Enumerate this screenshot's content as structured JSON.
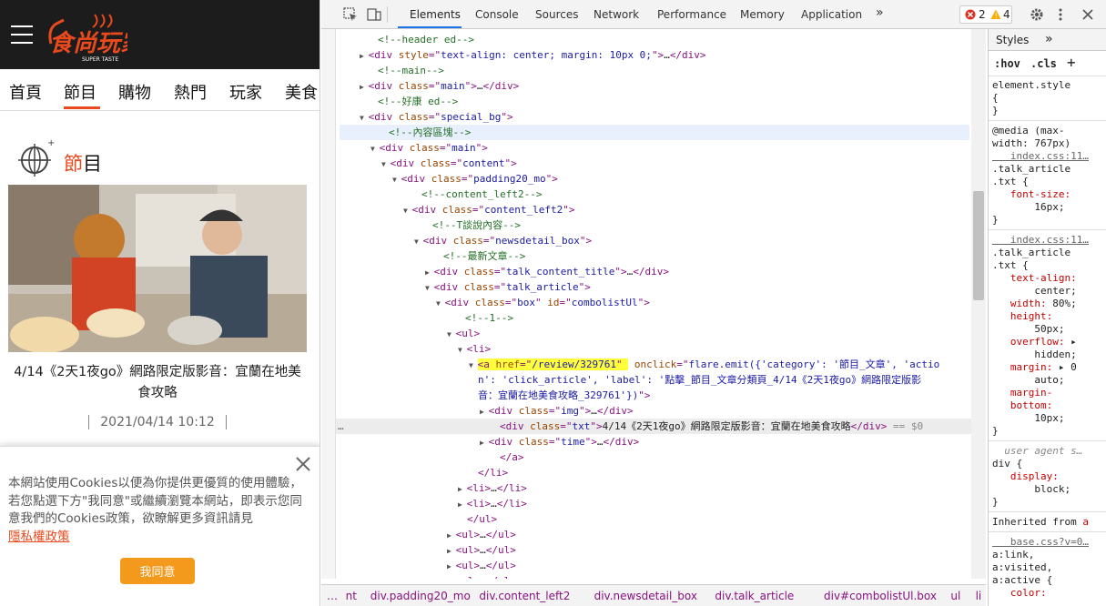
{
  "site": {
    "logo_text": "食尚玩家",
    "logo_sub": "SUPER TASTE",
    "nav": [
      "首頁",
      "節目",
      "購物",
      "熱門",
      "玩家",
      "美食"
    ],
    "section_title_hl": "節",
    "section_title_rest": "目",
    "article_title": "4/14《2天1夜go》網路限定版影音：宜蘭在地美食攻略",
    "article_time": "2021/04/14 10:12",
    "cookie_text": "本網站使用Cookies以便為你提供更優質的使用體驗，若您點選下方\"我同意\"或繼續瀏覽本網站，即表示您同意我們的Cookies政策，欲瞭解更多資訊請見",
    "cookie_link": "隱私權政策",
    "cookie_button": "我同意"
  },
  "devtools": {
    "tabs": [
      "Elements",
      "Console",
      "Sources",
      "Network",
      "Performance",
      "Memory",
      "Application"
    ],
    "more": "»",
    "errors": "2",
    "warnings": "4",
    "dom_lines": [
      {
        "indent": 62,
        "parts": [
          [
            "cmt",
            "<!--header ed-->"
          ]
        ]
      },
      {
        "indent": 52,
        "tri": "▶",
        "parts": [
          [
            "tag",
            "<div "
          ],
          [
            "attr",
            "style"
          ],
          [
            "tag",
            "=\""
          ],
          [
            "val",
            "text-align: center; margin: 10px 0;"
          ],
          [
            "tag",
            "\">"
          ],
          [
            "txt",
            "…"
          ],
          [
            "tag",
            "</div>"
          ]
        ]
      },
      {
        "indent": 62,
        "parts": [
          [
            "cmt",
            "<!--main-->"
          ]
        ]
      },
      {
        "indent": 52,
        "tri": "▶",
        "parts": [
          [
            "tag",
            "<div "
          ],
          [
            "attr",
            "class"
          ],
          [
            "tag",
            "=\""
          ],
          [
            "val",
            "main"
          ],
          [
            "tag",
            "\">"
          ],
          [
            "txt",
            "…"
          ],
          [
            "tag",
            "</div>"
          ]
        ]
      },
      {
        "indent": 62,
        "parts": [
          [
            "cmt",
            "<!--好康 ed-->"
          ]
        ]
      },
      {
        "indent": 52,
        "tri": "▼",
        "parts": [
          [
            "tag",
            "<div "
          ],
          [
            "attr",
            "class"
          ],
          [
            "tag",
            "=\""
          ],
          [
            "val",
            "special_bg"
          ],
          [
            "tag",
            "\">"
          ]
        ]
      },
      {
        "indent": 74,
        "sel": true,
        "parts": [
          [
            "cmt",
            "<!--內容區塊-->"
          ]
        ]
      },
      {
        "indent": 64,
        "tri": "▼",
        "parts": [
          [
            "tag",
            "<div "
          ],
          [
            "attr",
            "class"
          ],
          [
            "tag",
            "=\""
          ],
          [
            "val",
            "main"
          ],
          [
            "tag",
            "\">"
          ]
        ]
      },
      {
        "indent": 76,
        "tri": "▼",
        "parts": [
          [
            "tag",
            "<div "
          ],
          [
            "attr",
            "class"
          ],
          [
            "tag",
            "=\""
          ],
          [
            "val",
            "content"
          ],
          [
            "tag",
            "\">"
          ]
        ]
      },
      {
        "indent": 88,
        "tri": "▼",
        "parts": [
          [
            "tag",
            "<div "
          ],
          [
            "attr",
            "class"
          ],
          [
            "tag",
            "=\""
          ],
          [
            "val",
            "padding20_mo"
          ],
          [
            "tag",
            "\">"
          ]
        ]
      },
      {
        "indent": 110,
        "parts": [
          [
            "cmt",
            "<!--content_left2-->"
          ]
        ]
      },
      {
        "indent": 100,
        "tri": "▼",
        "parts": [
          [
            "tag",
            "<div "
          ],
          [
            "attr",
            "class"
          ],
          [
            "tag",
            "=\""
          ],
          [
            "val",
            "content_left2"
          ],
          [
            "tag",
            "\">"
          ]
        ]
      },
      {
        "indent": 122,
        "parts": [
          [
            "cmt",
            "<!--T談說內容-->"
          ]
        ]
      },
      {
        "indent": 112,
        "tri": "▼",
        "parts": [
          [
            "tag",
            "<div "
          ],
          [
            "attr",
            "class"
          ],
          [
            "tag",
            "=\""
          ],
          [
            "val",
            "newsdetail_box"
          ],
          [
            "tag",
            "\">"
          ]
        ]
      },
      {
        "indent": 134,
        "parts": [
          [
            "cmt",
            "<!--最新文章-->"
          ]
        ]
      },
      {
        "indent": 124,
        "tri": "▶",
        "parts": [
          [
            "tag",
            "<div "
          ],
          [
            "attr",
            "class"
          ],
          [
            "tag",
            "=\""
          ],
          [
            "val",
            "talk_content_title"
          ],
          [
            "tag",
            "\">"
          ],
          [
            "txt",
            "…"
          ],
          [
            "tag",
            "</div>"
          ]
        ]
      },
      {
        "indent": 124,
        "tri": "▼",
        "parts": [
          [
            "tag",
            "<div "
          ],
          [
            "attr",
            "class"
          ],
          [
            "tag",
            "=\""
          ],
          [
            "val",
            "talk_article"
          ],
          [
            "tag",
            "\">"
          ]
        ]
      },
      {
        "indent": 136,
        "tri": "▼",
        "parts": [
          [
            "tag",
            "<div "
          ],
          [
            "attr",
            "class"
          ],
          [
            "tag",
            "=\""
          ],
          [
            "val",
            "box"
          ],
          [
            "tag",
            "\" "
          ],
          [
            "attr",
            "id"
          ],
          [
            "tag",
            "=\""
          ],
          [
            "val",
            "combolistUl"
          ],
          [
            "tag",
            "\">"
          ]
        ]
      },
      {
        "indent": 158,
        "parts": [
          [
            "cmt",
            "<!--1-->"
          ]
        ]
      },
      {
        "indent": 148,
        "tri": "▼",
        "parts": [
          [
            "tag",
            "<ul>"
          ]
        ]
      },
      {
        "indent": 160,
        "tri": "▼",
        "parts": [
          [
            "tag",
            "<li>"
          ]
        ]
      },
      {
        "indent": 172,
        "tri": "▼",
        "yellow": true,
        "parts": [
          [
            "tag",
            "<a "
          ],
          [
            "attr",
            "href"
          ],
          [
            "tag",
            "=\""
          ],
          [
            "val",
            "/review/329761"
          ],
          [
            "tag",
            "\" "
          ],
          [
            "attr",
            " onclick"
          ],
          [
            "tag",
            "=\""
          ],
          [
            "val",
            "flare.emit({'category': '節目_文章', 'actio"
          ]
        ]
      },
      {
        "indent": 172,
        "parts": [
          [
            "val",
            "n': 'click_article', 'label': '點擊_節目_文章分類頁_4/14《2天1夜go》網路限定版影"
          ]
        ]
      },
      {
        "indent": 172,
        "parts": [
          [
            "val",
            "音：宜蘭在地美食攻略_329761'})"
          ],
          [
            "tag",
            "\">"
          ]
        ]
      },
      {
        "indent": 184,
        "tri": "▶",
        "parts": [
          [
            "tag",
            "<div "
          ],
          [
            "attr",
            "class"
          ],
          [
            "tag",
            "=\""
          ],
          [
            "val",
            "img"
          ],
          [
            "tag",
            "\">"
          ],
          [
            "txt",
            "…"
          ],
          [
            "tag",
            "</div>"
          ]
        ]
      },
      {
        "indent": 196,
        "sel2": true,
        "dots": "…",
        "parts": [
          [
            "tag",
            "<div "
          ],
          [
            "attr",
            "class"
          ],
          [
            "tag",
            "=\""
          ],
          [
            "val",
            "txt"
          ],
          [
            "tag",
            "\">"
          ],
          [
            "txt",
            "4/14《2天1夜go》網路限定版影音：宜蘭在地美食攻略"
          ],
          [
            "tag",
            "</div>"
          ],
          [
            "eq",
            " == $0"
          ]
        ]
      },
      {
        "indent": 184,
        "tri": "▶",
        "parts": [
          [
            "tag",
            "<div "
          ],
          [
            "attr",
            "class"
          ],
          [
            "tag",
            "=\""
          ],
          [
            "val",
            "time"
          ],
          [
            "tag",
            "\">"
          ],
          [
            "txt",
            "…"
          ],
          [
            "tag",
            "</div>"
          ]
        ]
      },
      {
        "indent": 196,
        "parts": [
          [
            "tag",
            "</a>"
          ]
        ]
      },
      {
        "indent": 172,
        "parts": [
          [
            "tag",
            "</li>"
          ]
        ]
      },
      {
        "indent": 160,
        "tri": "▶",
        "parts": [
          [
            "tag",
            "<li>"
          ],
          [
            "txt",
            "…"
          ],
          [
            "tag",
            "</li>"
          ]
        ]
      },
      {
        "indent": 160,
        "tri": "▶",
        "parts": [
          [
            "tag",
            "<li>"
          ],
          [
            "txt",
            "…"
          ],
          [
            "tag",
            "</li>"
          ]
        ]
      },
      {
        "indent": 160,
        "parts": [
          [
            "tag",
            "</ul>"
          ]
        ]
      },
      {
        "indent": 148,
        "tri": "▶",
        "parts": [
          [
            "tag",
            "<ul>"
          ],
          [
            "txt",
            "…"
          ],
          [
            "tag",
            "</ul>"
          ]
        ]
      },
      {
        "indent": 148,
        "tri": "▶",
        "parts": [
          [
            "tag",
            "<ul>"
          ],
          [
            "txt",
            "…"
          ],
          [
            "tag",
            "</ul>"
          ]
        ]
      },
      {
        "indent": 148,
        "tri": "▶",
        "parts": [
          [
            "tag",
            "<ul>"
          ],
          [
            "txt",
            "…"
          ],
          [
            "tag",
            "</ul>"
          ]
        ]
      },
      {
        "indent": 148,
        "tri": "▶",
        "parts": [
          [
            "tag",
            "<ul>"
          ],
          [
            "txt",
            "…"
          ],
          [
            "tag",
            "</ul>"
          ]
        ]
      }
    ],
    "breadcrumbs": [
      "…",
      "nt",
      "div.padding20_mo",
      "div.content_left2",
      "div.newsdetail_box",
      "div.talk_article",
      "div#combolistUl.box",
      "ul",
      "li",
      "a",
      "div.txt"
    ],
    "styles_tabs": [
      "Styles",
      "»"
    ],
    "styles_filter": [
      ":hov",
      ".cls",
      "+"
    ],
    "styles_lines": [
      {
        "cls": "ssel",
        "t": "element.style"
      },
      {
        "cls": "ssel",
        "t": "{"
      },
      {
        "cls": "ssel",
        "t": "}"
      },
      {
        "div": true
      },
      {
        "cls": "ssel",
        "t": "@media (max-"
      },
      {
        "cls": "ssel",
        "t": "width: 767px)"
      },
      {
        "cls": "slink",
        "t": "   index.css:11…"
      },
      {
        "cls": "ssel",
        "t": ".talk_article"
      },
      {
        "cls": "ssel",
        "t": ".txt {"
      },
      {
        "cls": "sprop",
        "t": "   font-size:",
        "v": ""
      },
      {
        "cls": "sval",
        "t": "       16px;"
      },
      {
        "cls": "ssel",
        "t": "}"
      },
      {
        "div": true
      },
      {
        "cls": "slink",
        "t": "   index.css:11…"
      },
      {
        "cls": "ssel",
        "t": ".talk_article"
      },
      {
        "cls": "ssel",
        "t": ".txt {"
      },
      {
        "cls": "sprop",
        "t": "   text-align:"
      },
      {
        "cls": "sval",
        "t": "       center;"
      },
      {
        "cls": "sprop",
        "t": "   width: ",
        "v": "80%;"
      },
      {
        "cls": "sprop",
        "t": "   height:"
      },
      {
        "cls": "sval",
        "t": "       50px;"
      },
      {
        "cls": "sprop",
        "t": "   overflow: ",
        "v": "▸"
      },
      {
        "cls": "sval",
        "t": "       hidden;"
      },
      {
        "cls": "sprop",
        "t": "   margin: ",
        "v": "▸ 0"
      },
      {
        "cls": "sval",
        "t": "       auto;"
      },
      {
        "cls": "sprop",
        "t": "   margin-"
      },
      {
        "cls": "sprop",
        "t": "   bottom:"
      },
      {
        "cls": "sval",
        "t": "       10px;"
      },
      {
        "cls": "ssel",
        "t": "}"
      },
      {
        "div": true
      },
      {
        "cls": "scmt",
        "t": "  user agent s…"
      },
      {
        "cls": "ssel",
        "t": "div {"
      },
      {
        "cls": "sprop",
        "t": "   display:"
      },
      {
        "cls": "sval",
        "t": "       block;"
      },
      {
        "cls": "ssel",
        "t": "}"
      },
      {
        "div": true
      },
      {
        "cls": "ssel",
        "t": "Inherited from ",
        "v": "a"
      },
      {
        "div": true
      },
      {
        "cls": "slink",
        "t": "   base.css?v=0…"
      },
      {
        "cls": "ssel",
        "t": "a:link,"
      },
      {
        "cls": "ssel",
        "t": "a:visited,"
      },
      {
        "cls": "ssel",
        "t": "a:active {"
      },
      {
        "cls": "sprop",
        "t": "   color:"
      }
    ]
  },
  "colors": {
    "brand_orange": "#e8491d",
    "cookie_button": "#f39a1d",
    "devtools_accent": "#1a73e8"
  }
}
